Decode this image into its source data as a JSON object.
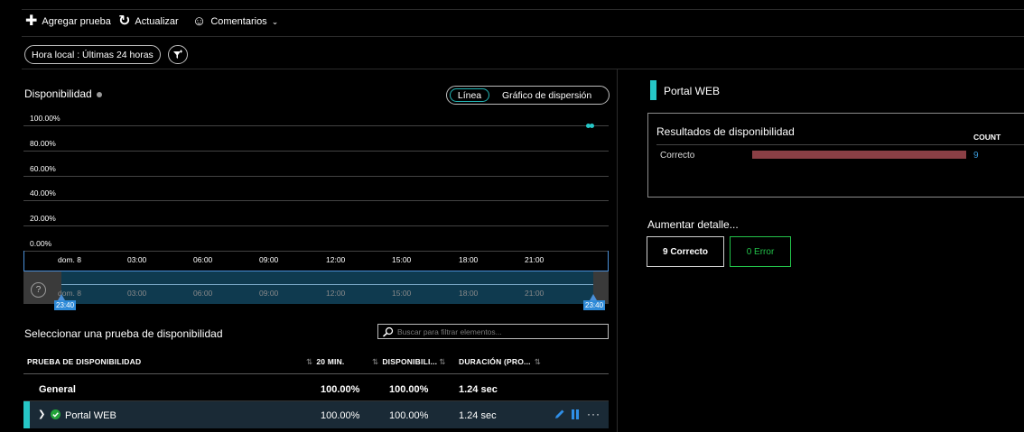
{
  "toolbar": {
    "add_label": "Agregar prueba",
    "refresh_label": "Actualizar",
    "feedback_label": "Comentarios"
  },
  "time_filter": {
    "label": "Hora local : Últimas 24 horas"
  },
  "chart_panel": {
    "title": "Disponibilidad",
    "toggle_active": "Línea",
    "toggle_inactive": "Gráfico de dispersión"
  },
  "chart_data": {
    "type": "line",
    "title": "Disponibilidad",
    "yticks": [
      "100.00%",
      "80.00%",
      "60.00%",
      "40.00%",
      "20.00%",
      "0.00%"
    ],
    "ylim": [
      0,
      100
    ],
    "xticks": [
      "dom. 8",
      "03:00",
      "06:00",
      "09:00",
      "12:00",
      "15:00",
      "18:00",
      "21:00"
    ],
    "series": [
      {
        "values": [
          100,
          100
        ],
        "color": "#26c6c6"
      }
    ],
    "grid": true
  },
  "brush": {
    "xticks": [
      "dom. 8",
      "03:00",
      "06:00",
      "09:00",
      "12:00",
      "15:00",
      "18:00",
      "21:00"
    ],
    "start_label": "23:40",
    "end_label": "23:40"
  },
  "test_list": {
    "title": "Seleccionar una prueba de disponibilidad",
    "search_placeholder": "Buscar para filtrar elementos...",
    "columns": [
      "PRUEBA DE DISPONIBILIDAD",
      "20 MIN.",
      "DISPONIBILI...",
      "DURACIÓN (PRO..."
    ],
    "rows": [
      {
        "name": "General",
        "min20": "100.00%",
        "avail": "100.00%",
        "duration": "1.24 sec"
      },
      {
        "name": "Portal WEB",
        "min20": "100.00%",
        "avail": "100.00%",
        "duration": "1.24 sec"
      }
    ]
  },
  "detail": {
    "title": "Portal WEB",
    "results_title": "Resultados de disponibilidad",
    "count_header": "COUNT",
    "result_label": "Correcto",
    "result_count": "9",
    "drill_title": "Aumentar detalle...",
    "ok_button": "9 Correcto",
    "error_button": "0 Error"
  },
  "colors": {
    "accent": "#26c6c6",
    "bar": "#8a3f45",
    "success": "#23c24a"
  }
}
